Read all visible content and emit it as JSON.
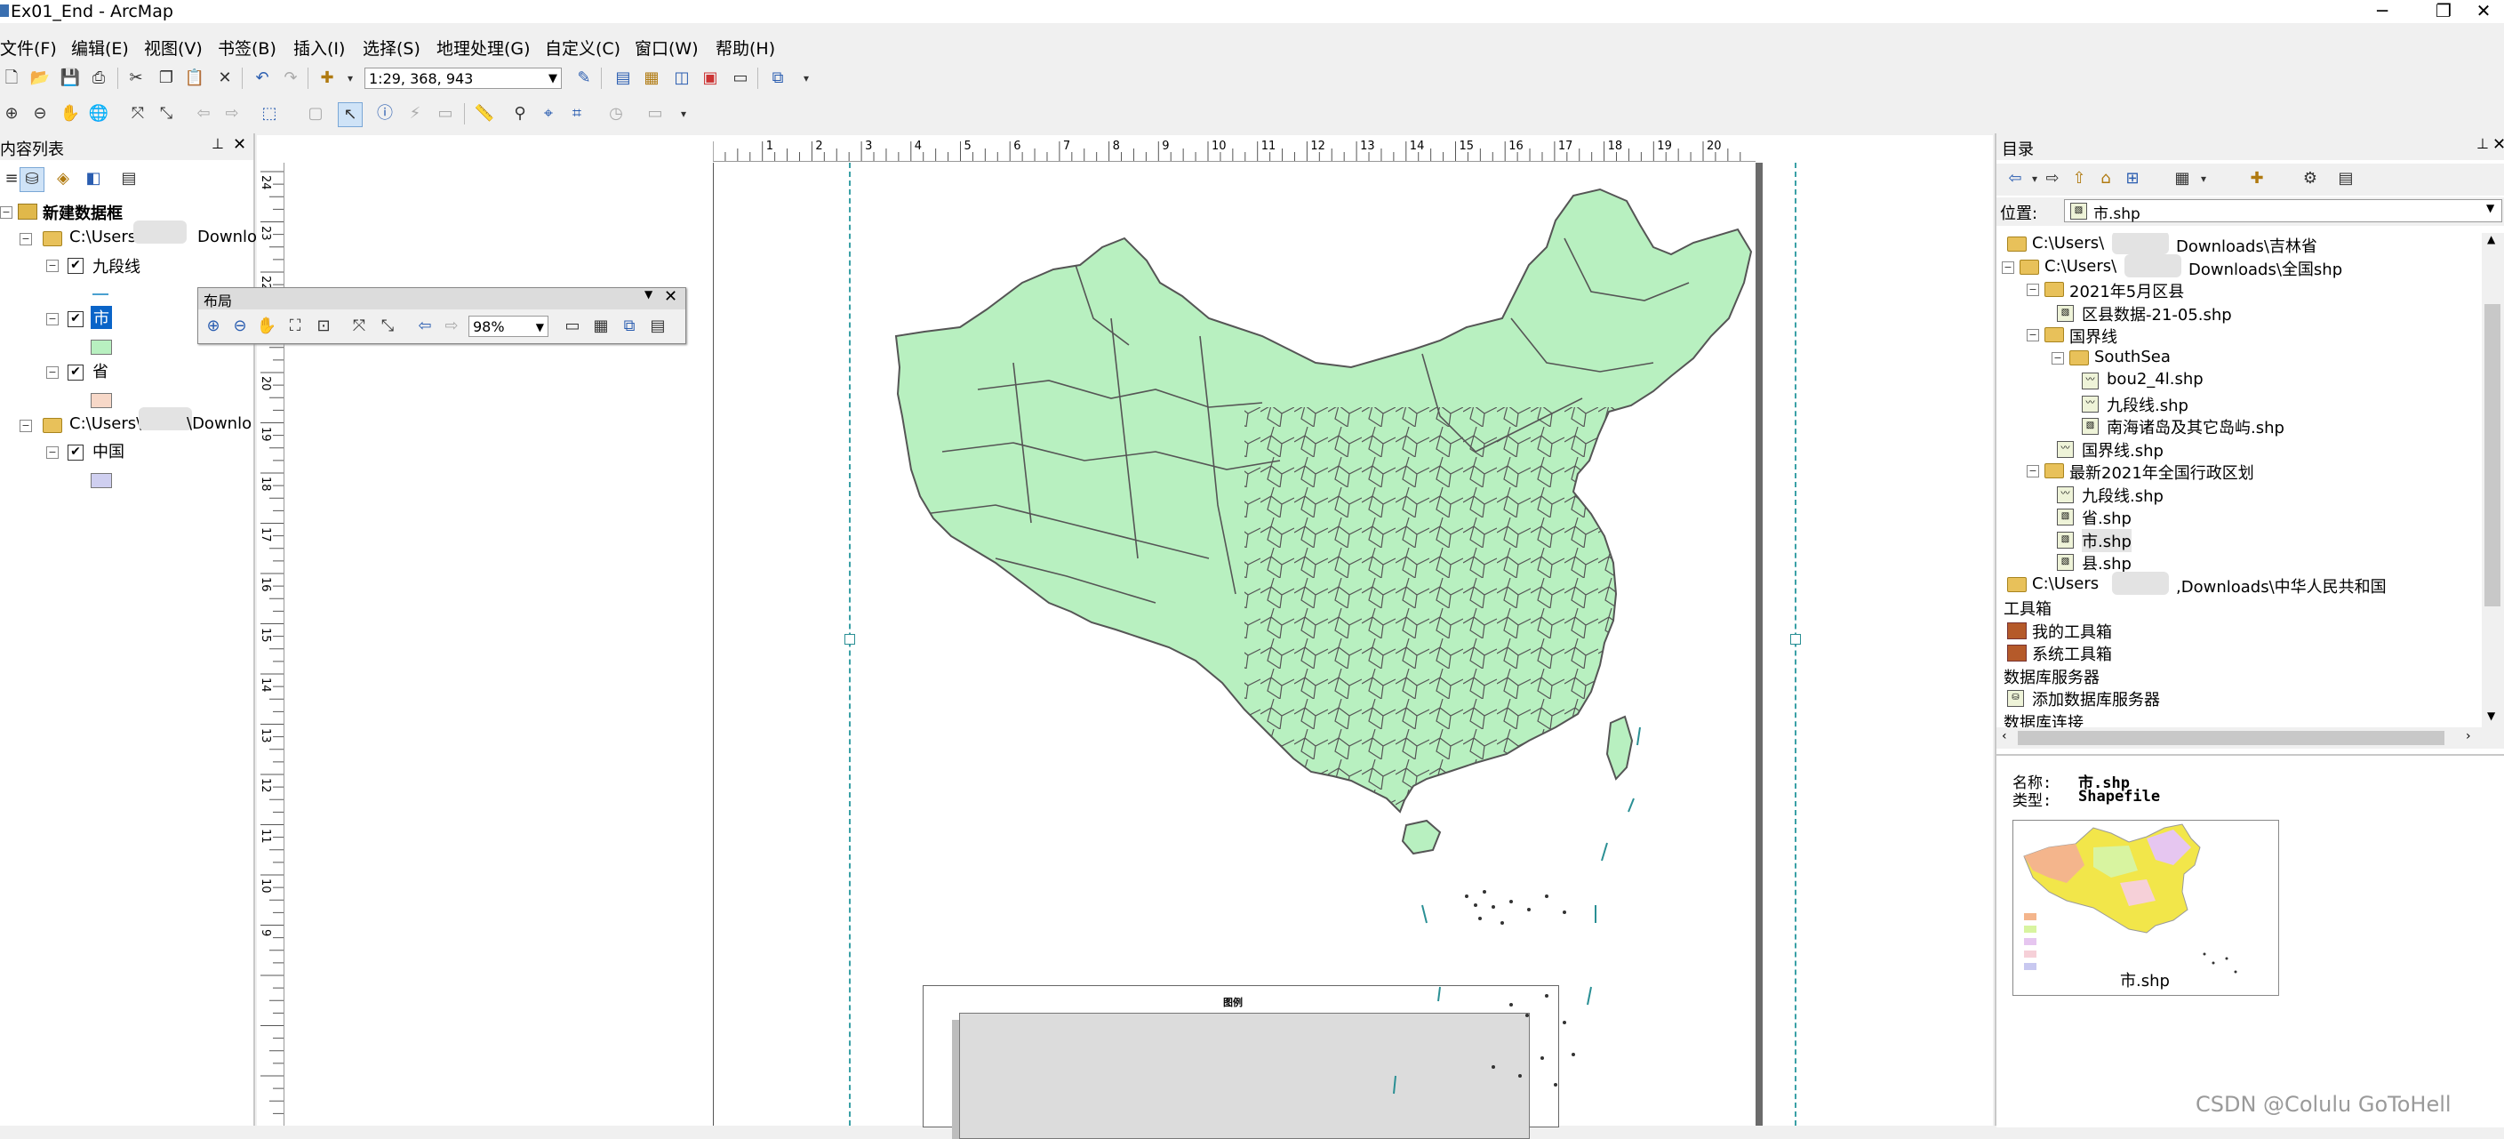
{
  "window": {
    "title": "Ex01_End - ArcMap",
    "min_glyph": "─",
    "max_glyph": "❐",
    "close_glyph": "✕"
  },
  "menu": [
    "文件(F)",
    "编辑(E)",
    "视图(V)",
    "书签(B)",
    "插入(I)",
    "选择(S)",
    "地理处理(G)",
    "自定义(C)",
    "窗口(W)",
    "帮助(H)"
  ],
  "toolbar": {
    "scale": "1:29, 368, 943"
  },
  "toc": {
    "title": "内容列表",
    "pin_glyph": "ᵖ",
    "close_glyph": "✕",
    "frame": "新建数据框",
    "group1_path": "C:\\Users",
    "group1_path_tail": "Downlo",
    "layers1": [
      {
        "name": "九段线",
        "checked": true,
        "swatch": "line",
        "color": "#4aa0d0"
      },
      {
        "name": "市",
        "checked": true,
        "selected": true,
        "swatch": "fill",
        "color": "#b8f0c0"
      },
      {
        "name": "省",
        "checked": true,
        "swatch": "fill",
        "color": "#f7d8c8"
      }
    ],
    "group2_path": "C:\\Users\\",
    "group2_path_tail": "\\Downlo",
    "layers2": [
      {
        "name": "中国",
        "checked": true,
        "swatch": "fill",
        "color": "#cfcff0"
      }
    ]
  },
  "layout_toolbar": {
    "title": "布局",
    "zoom": "98%"
  },
  "ruler": {
    "h": [
      "1",
      "2",
      "3",
      "4",
      "5",
      "6",
      "7",
      "8",
      "9",
      "10",
      "11",
      "12",
      "13",
      "14",
      "15",
      "16",
      "17",
      "18",
      "19",
      "20"
    ],
    "v": [
      "24",
      "23",
      "22",
      "21",
      "20",
      "19",
      "18",
      "17",
      "16",
      "15",
      "14",
      "13",
      "12",
      "11",
      "10",
      "9"
    ]
  },
  "map": {
    "fill_color": "#b8f0c0",
    "stroke_color": "#555555"
  },
  "legend": {
    "title": "图例"
  },
  "catalog": {
    "title": "目录",
    "location_label": "位置:",
    "location_value": "市.shp",
    "tree": [
      {
        "label": "C:\\Users\\",
        "tail": "Downloads\\吉林省",
        "type": "folder",
        "indent": 0
      },
      {
        "label": "C:\\Users\\",
        "tail": "Downloads\\全国shp",
        "type": "folder",
        "indent": 0,
        "expander": "⊟"
      },
      {
        "label": "2021年5月区县",
        "type": "folder",
        "indent": 1,
        "expander": "⊟"
      },
      {
        "label": "区县数据-21-05.shp",
        "type": "shp",
        "indent": 2
      },
      {
        "label": "国界线",
        "type": "folder",
        "indent": 1,
        "expander": "⊟"
      },
      {
        "label": "SouthSea",
        "type": "folder",
        "indent": 2,
        "expander": "⊟"
      },
      {
        "label": "bou2_4l.shp",
        "type": "line",
        "indent": 3
      },
      {
        "label": "九段线.shp",
        "type": "line",
        "indent": 3
      },
      {
        "label": "南海诸岛及其它岛屿.shp",
        "type": "shp",
        "indent": 3
      },
      {
        "label": "国界线.shp",
        "type": "line",
        "indent": 2
      },
      {
        "label": "最新2021年全国行政区划",
        "type": "folder",
        "indent": 1,
        "expander": "⊟"
      },
      {
        "label": "九段线.shp",
        "type": "line",
        "indent": 2
      },
      {
        "label": "省.shp",
        "type": "shp",
        "indent": 2
      },
      {
        "label": "市.shp",
        "type": "shp",
        "indent": 2,
        "selected": true
      },
      {
        "label": "县.shp",
        "type": "shp",
        "indent": 2
      },
      {
        "label": "C:\\Users",
        "tail": ",Downloads\\中华人民共和国",
        "type": "folder",
        "indent": 0
      },
      {
        "label": "工具箱",
        "type": "plain",
        "indent": -1
      },
      {
        "label": "我的工具箱",
        "type": "toolbox",
        "indent": 0
      },
      {
        "label": "系统工具箱",
        "type": "toolbox",
        "indent": 0
      },
      {
        "label": "数据库服务器",
        "type": "plain",
        "indent": -1
      },
      {
        "label": "添加数据库服务器",
        "type": "server",
        "indent": 0
      },
      {
        "label": "数据库连接",
        "type": "plain",
        "indent": -1
      }
    ],
    "preview": {
      "name_label": "名称:",
      "name_value": "市.shp",
      "type_label": "类型:",
      "type_value": "Shapefile",
      "thumb_caption": "市.shp"
    }
  },
  "watermark": "CSDN @Colulu GoToHell"
}
